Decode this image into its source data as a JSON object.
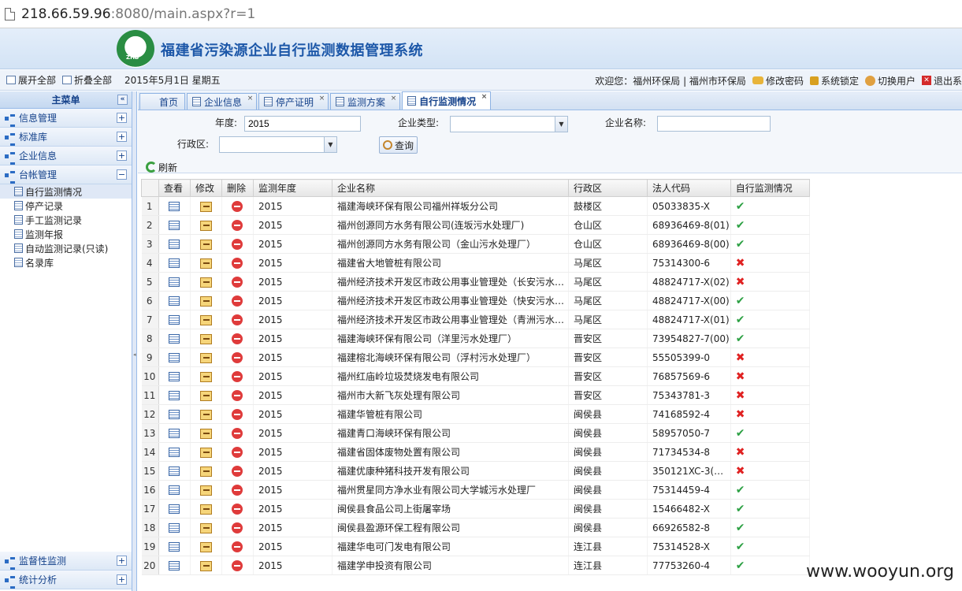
{
  "browser": {
    "url_host": "218.66.59.96",
    "url_rest": ":8080/main.aspx?r=1"
  },
  "header": {
    "title": "福建省污染源企业自行监测数据管理系统",
    "logo_text": "ZHB"
  },
  "toolbar": {
    "expand_all": "展开全部",
    "collapse_all": "折叠全部",
    "date": "2015年5月1日 星期五",
    "welcome": "欢迎您：福州环保局 | 福州市环保局",
    "change_password": "修改密码",
    "lock": "系统锁定",
    "switch_user": "切换用户",
    "logout": "退出系"
  },
  "sidebar": {
    "title": "主菜单",
    "groups": [
      "信息管理",
      "标准库",
      "企业信息",
      "台帐管理"
    ],
    "sub_items": [
      "自行监测情况",
      "停产记录",
      "手工监测记录",
      "监测年报",
      "自动监测记录(只读)",
      "名录库"
    ],
    "bottom_groups": [
      "监督性监测",
      "统计分析"
    ]
  },
  "tabs": [
    "首页",
    "企业信息",
    "停产证明",
    "监测方案",
    "自行监测情况"
  ],
  "filters": {
    "year_label": "年度:",
    "year_value": "2015",
    "type_label": "企业类型:",
    "name_label": "企业名称:",
    "district_label": "行政区:",
    "search_button": "查询"
  },
  "refresh_label": "刷新",
  "grid": {
    "columns": [
      "查看",
      "修改",
      "删除",
      "监测年度",
      "企业名称",
      "行政区",
      "法人代码",
      "自行监测情况"
    ],
    "rows": [
      [
        "1",
        "2015",
        "福建海峡环保有限公司福州祥坂分公司",
        "鼓楼区",
        "05033835-X",
        "ok"
      ],
      [
        "2",
        "2015",
        "福州创源同方水务有限公司(连坂污水处理厂)",
        "仓山区",
        "68936469-8(01)",
        "ok"
      ],
      [
        "3",
        "2015",
        "福州创源同方水务有限公司（金山污水处理厂）",
        "仓山区",
        "68936469-8(00)",
        "ok"
      ],
      [
        "4",
        "2015",
        "福建省大地管桩有限公司",
        "马尾区",
        "75314300-6",
        "no"
      ],
      [
        "5",
        "2015",
        "福州经济技术开发区市政公用事业管理处（长安污水…",
        "马尾区",
        "48824717-X(02)",
        "no"
      ],
      [
        "6",
        "2015",
        "福州经济技术开发区市政公用事业管理处（快安污水…",
        "马尾区",
        "48824717-X(00)",
        "ok"
      ],
      [
        "7",
        "2015",
        "福州经济技术开发区市政公用事业管理处（青洲污水…",
        "马尾区",
        "48824717-X(01)",
        "ok"
      ],
      [
        "8",
        "2015",
        "福建海峡环保有限公司（洋里污水处理厂）",
        "晋安区",
        "73954827-7(00)",
        "ok"
      ],
      [
        "9",
        "2015",
        "福建榕北海峡环保有限公司（浮村污水处理厂）",
        "晋安区",
        "55505399-0",
        "no"
      ],
      [
        "10",
        "2015",
        "福州红庙岭垃圾焚烧发电有限公司",
        "晋安区",
        "76857569-6",
        "no"
      ],
      [
        "11",
        "2015",
        "福州市大新飞灰处理有限公司",
        "晋安区",
        "75343781-3",
        "no"
      ],
      [
        "12",
        "2015",
        "福建华管桩有限公司",
        "闽侯县",
        "74168592-4",
        "no"
      ],
      [
        "13",
        "2015",
        "福建青口海峡环保有限公司",
        "闽侯县",
        "58957050-7",
        "ok"
      ],
      [
        "14",
        "2015",
        "福建省固体废物处置有限公司",
        "闽侯县",
        "71734534-8",
        "no"
      ],
      [
        "15",
        "2015",
        "福建优康种猪科技开发有限公司",
        "闽侯县",
        "350121XC-3(…",
        "no"
      ],
      [
        "16",
        "2015",
        "福州贯星同方净水业有限公司大学城污水处理厂",
        "闽侯县",
        "75314459-4",
        "ok"
      ],
      [
        "17",
        "2015",
        "闽侯县食品公司上街屠宰场",
        "闽侯县",
        "15466482-X",
        "ok"
      ],
      [
        "18",
        "2015",
        "闽侯县盈源环保工程有限公司",
        "闽侯县",
        "66926582-8",
        "ok"
      ],
      [
        "19",
        "2015",
        "福建华电可门发电有限公司",
        "连江县",
        "75314528-X",
        "ok"
      ],
      [
        "20",
        "2015",
        "福建学申投资有限公司",
        "连江县",
        "77753260-4",
        "ok"
      ]
    ]
  },
  "watermark": "www.wooyun.org",
  "colors": {
    "accent": "#15428b",
    "ok": "#2ca043",
    "no": "#e02222",
    "header_bg": "#d3e3f5"
  }
}
